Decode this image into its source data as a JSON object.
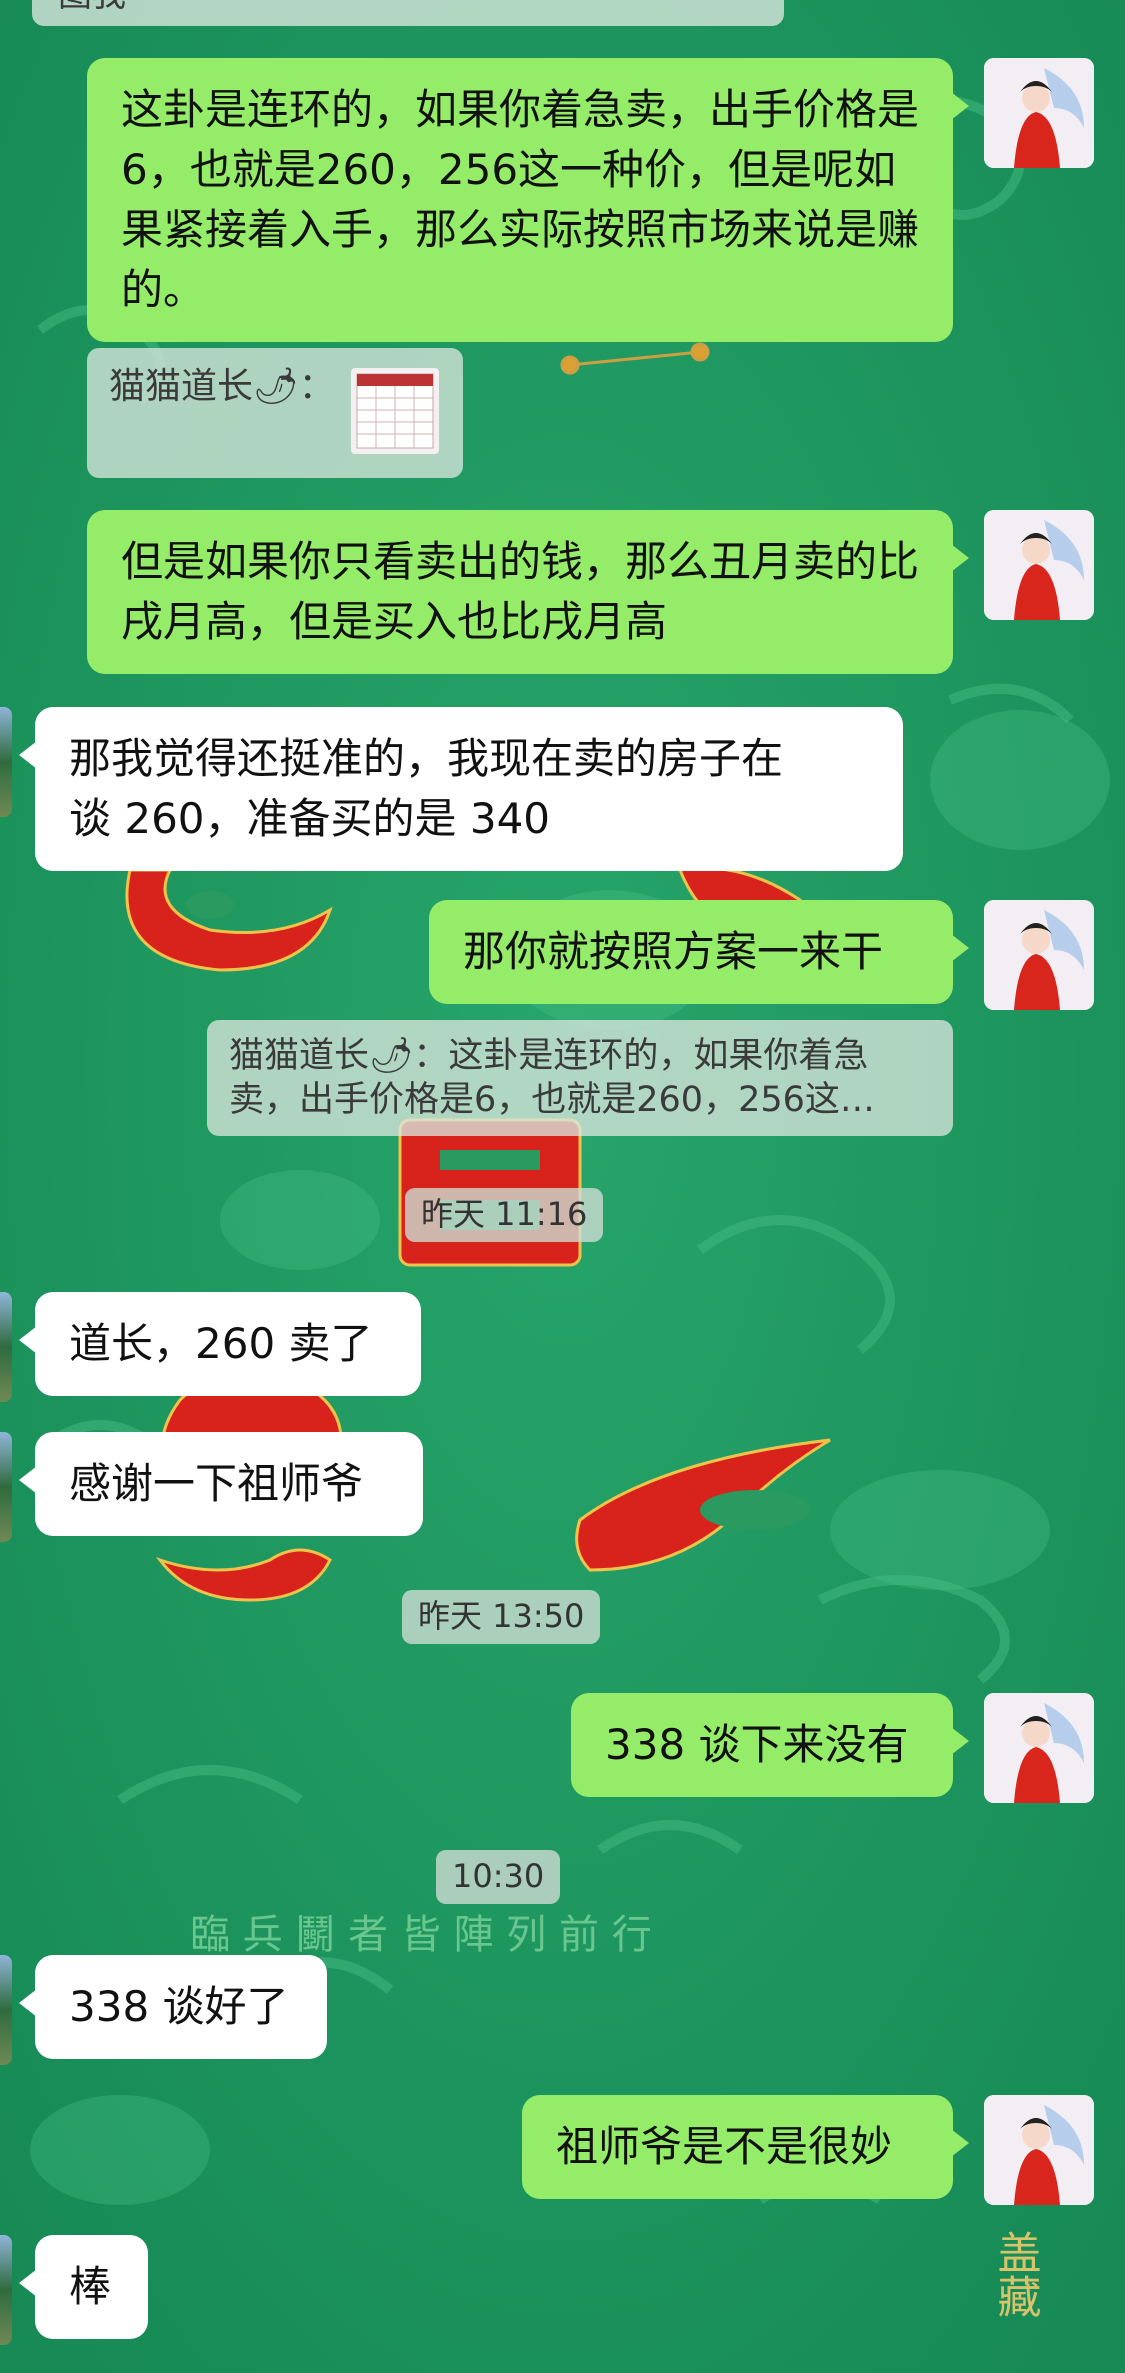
{
  "top_fragment": "图我",
  "sender_name": "猫猫道长",
  "sender_emoji": "🌶",
  "messages": {
    "m1": "这卦是连环的，如果你着急卖，出手价格是6，也就是260，256这一种价，但是呢如果紧接着入手，那么实际按照市场来说是赚的。",
    "quote_image_label": "猫猫道长🌶：",
    "m2": "但是如果你只看卖出的钱，那么丑月卖的比戌月高，但是买入也比戌月高",
    "m3_line1": "那我觉得还挺准的，我现在卖的房子在",
    "m3_line2": "谈 260，准备买的是 340",
    "m4": "那你就按照方案一来干",
    "quote2_line1": "猫猫道长🌶：这卦是连环的，如果你着急",
    "quote2_line2": "卖，出手价格是6，也就是260，256这…",
    "time1": "昨天 11:16",
    "m5": "道长，260 卖了",
    "m6": "感谢一下祖师爷",
    "time2": "昨天 13:50",
    "m7": "338 谈下来没有",
    "time3": "10:30",
    "m8": "338 谈好了",
    "m9": "祖师爷是不是很妙",
    "m10": "棒"
  },
  "background_text": {
    "motto": "臨 兵 鬭 者 皆 陣 列 前 行",
    "corner": "盖藏"
  },
  "colors": {
    "background": "#1f9a63",
    "my_bubble": "#95ec69",
    "their_bubble": "#ffffff",
    "red_motif": "#d8221c"
  }
}
